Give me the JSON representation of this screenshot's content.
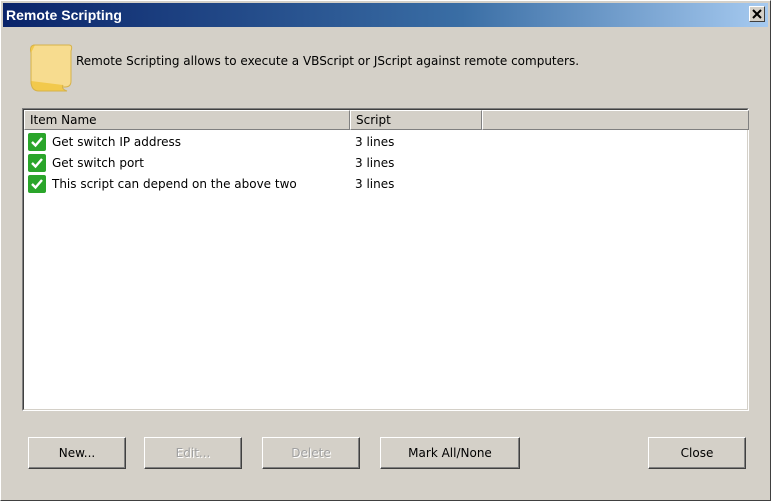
{
  "window": {
    "title": "Remote Scripting"
  },
  "description": "Remote Scripting allows to execute a VBScript or JScript against remote computers.",
  "list": {
    "columns": [
      "Item Name",
      "Script",
      ""
    ],
    "rows": [
      {
        "name": "Get switch IP address",
        "script": "3 lines",
        "checked": true
      },
      {
        "name": "Get switch port",
        "script": "3 lines",
        "checked": true
      },
      {
        "name": "This script can depend on the above two",
        "script": "3 lines",
        "checked": true
      }
    ]
  },
  "buttons": {
    "new": "New...",
    "edit": "Edit...",
    "delete": "Delete",
    "mark_all": "Mark All/None",
    "close": "Close"
  },
  "colors": {
    "check": "#2aa52a",
    "title_start": "#0a246a",
    "title_end": "#a6caf0"
  },
  "icons": {
    "header": "scroll-icon",
    "row": "checkbox-checked-icon",
    "close": "close-icon"
  }
}
